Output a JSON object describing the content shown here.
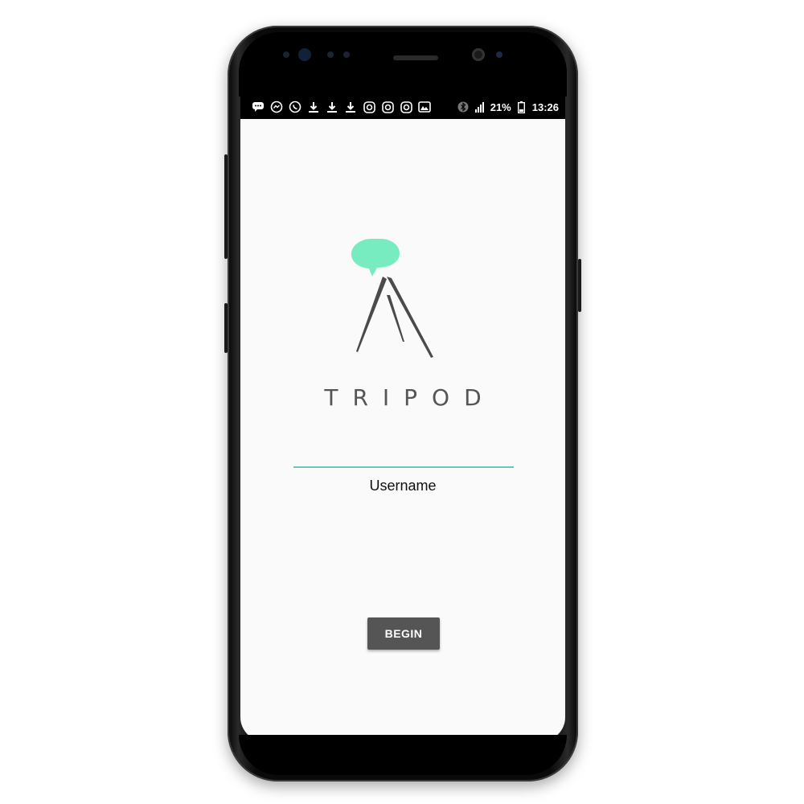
{
  "status_bar": {
    "notification_icons": [
      "chat-icon",
      "messenger-icon",
      "whatsapp-icon",
      "download-icon",
      "download-icon",
      "download-icon",
      "instagram-icon",
      "instagram-icon",
      "instagram-icon",
      "gallery-icon"
    ],
    "battery_percent": "21%",
    "time": "13:26"
  },
  "app": {
    "brand_name": "TRIPOD",
    "logo_bubble_color": "#78ecc1",
    "logo_leg_color": "#4a4a4a",
    "accent_color": "#6cc5b8"
  },
  "form": {
    "username_label": "Username",
    "username_value": "",
    "begin_label": "BEGIN"
  }
}
